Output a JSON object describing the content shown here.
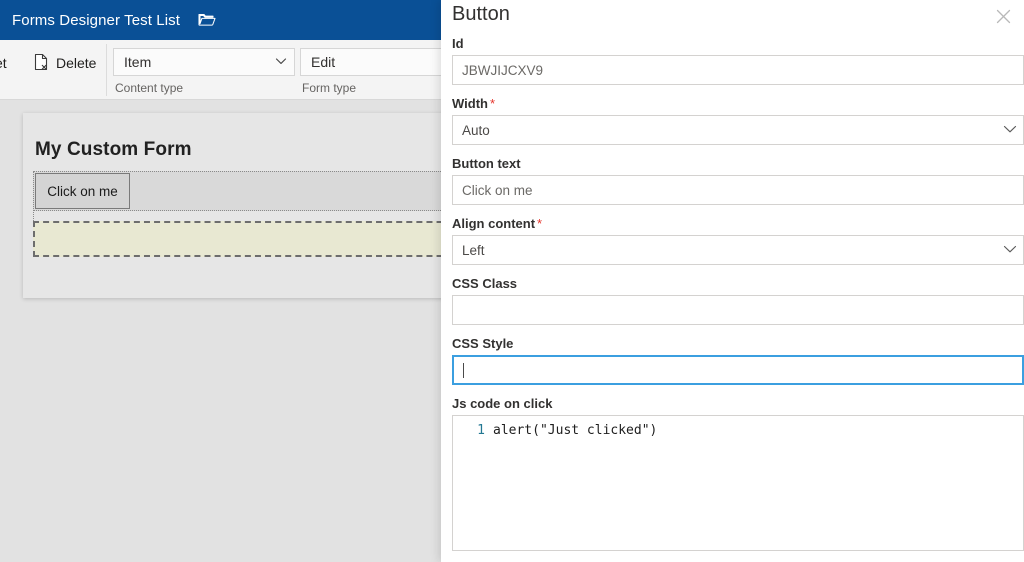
{
  "suite_bar": {
    "site_title": "Forms Designer Test List",
    "folder_icon": "open-folder-icon"
  },
  "ribbon": {
    "reset_label": "set",
    "delete_label": "Delete",
    "delete_icon": "delete-document-icon",
    "content_type": {
      "value": "Item",
      "group_label": "Content type",
      "chevron_icon": "chevron-down-icon"
    },
    "form_type": {
      "value": "Edit",
      "group_label": "Form type"
    }
  },
  "designer": {
    "form_title": "My Custom Form",
    "button_label": "Click on me",
    "drop_zone_label": ""
  },
  "panel": {
    "title": "Button",
    "close_icon": "close-icon",
    "fields": {
      "id": {
        "label": "Id",
        "value": "JBWJIJCXV9",
        "required": false
      },
      "width": {
        "label": "Width",
        "value": "Auto",
        "required": true,
        "required_mark": "*",
        "chevron_icon": "chevron-down-icon"
      },
      "button_text": {
        "label": "Button text",
        "value": "Click on me",
        "required": false
      },
      "align_content": {
        "label": "Align content",
        "value": "Left",
        "required": true,
        "required_mark": "*",
        "chevron_icon": "chevron-down-icon"
      },
      "css_class": {
        "label": "CSS Class",
        "value": "",
        "required": false
      },
      "css_style": {
        "label": "CSS Style",
        "value": "",
        "required": false,
        "focused": true
      },
      "js_code_on_click": {
        "label": "Js code on click",
        "line_number": "1",
        "code": "alert(\"Just clicked\")"
      }
    }
  },
  "colors": {
    "suite_bar_bg": "#0a5096",
    "canvas_bg": "#e2e2e2",
    "panel_bg": "#ffffff",
    "required_asterisk": "#e5332a",
    "focus_border": "#3b9fe0",
    "drop_zone_bg": "#e8e8d2",
    "gutter_number": "#237893"
  }
}
